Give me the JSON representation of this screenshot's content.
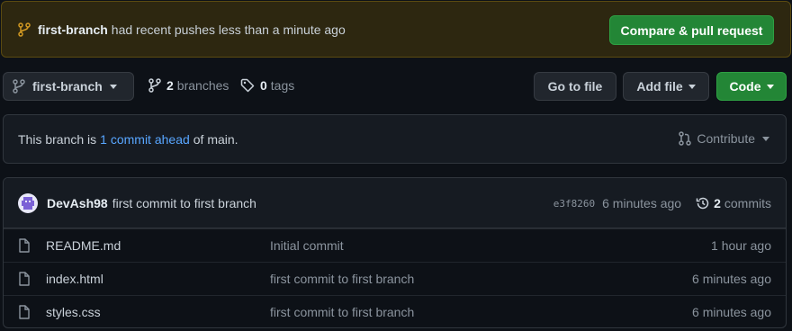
{
  "banner": {
    "branch": "first-branch",
    "message": "had recent pushes less than a minute ago",
    "button": "Compare & pull request"
  },
  "toolbar": {
    "branch_select": "first-branch",
    "branches_count": "2",
    "branches_label": "branches",
    "tags_count": "0",
    "tags_label": "tags",
    "goto_file": "Go to file",
    "add_file": "Add file",
    "code": "Code"
  },
  "ahead": {
    "prefix": "This branch is",
    "link": "1 commit ahead",
    "suffix": "of main.",
    "contribute": "Contribute"
  },
  "latest_commit": {
    "author": "DevAsh98",
    "message": "first commit to first branch",
    "sha": "e3f8260",
    "time": "6 minutes ago",
    "commits_count": "2",
    "commits_label": "commits"
  },
  "files": [
    {
      "name": "README.md",
      "message": "Initial commit",
      "time": "1 hour ago"
    },
    {
      "name": "index.html",
      "message": "first commit to first branch",
      "time": "6 minutes ago"
    },
    {
      "name": "styles.css",
      "message": "first commit to first branch",
      "time": "6 minutes ago"
    }
  ],
  "colors": {
    "accent_green": "#238636",
    "link_blue": "#58a6ff",
    "banner_bg": "#2d2710",
    "banner_icon": "#d29922"
  }
}
